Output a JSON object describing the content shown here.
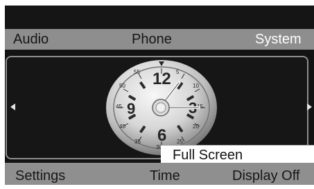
{
  "top_menu": {
    "audio_label": "Audio",
    "phone_label": "Phone",
    "system_label": "System"
  },
  "bottom_menu": {
    "settings_label": "Settings",
    "time_label": "Time",
    "display_off_label": "Display Off"
  },
  "popup": {
    "full_screen_label": "Full Screen"
  },
  "clock": {
    "numerals": [
      "12",
      "3",
      "6",
      "9"
    ],
    "outer_ticks": [
      "55",
      "5",
      "10",
      "15",
      "20",
      "25",
      "30",
      "35",
      "40",
      "45",
      "50"
    ],
    "accent": "#e7e7e7"
  }
}
